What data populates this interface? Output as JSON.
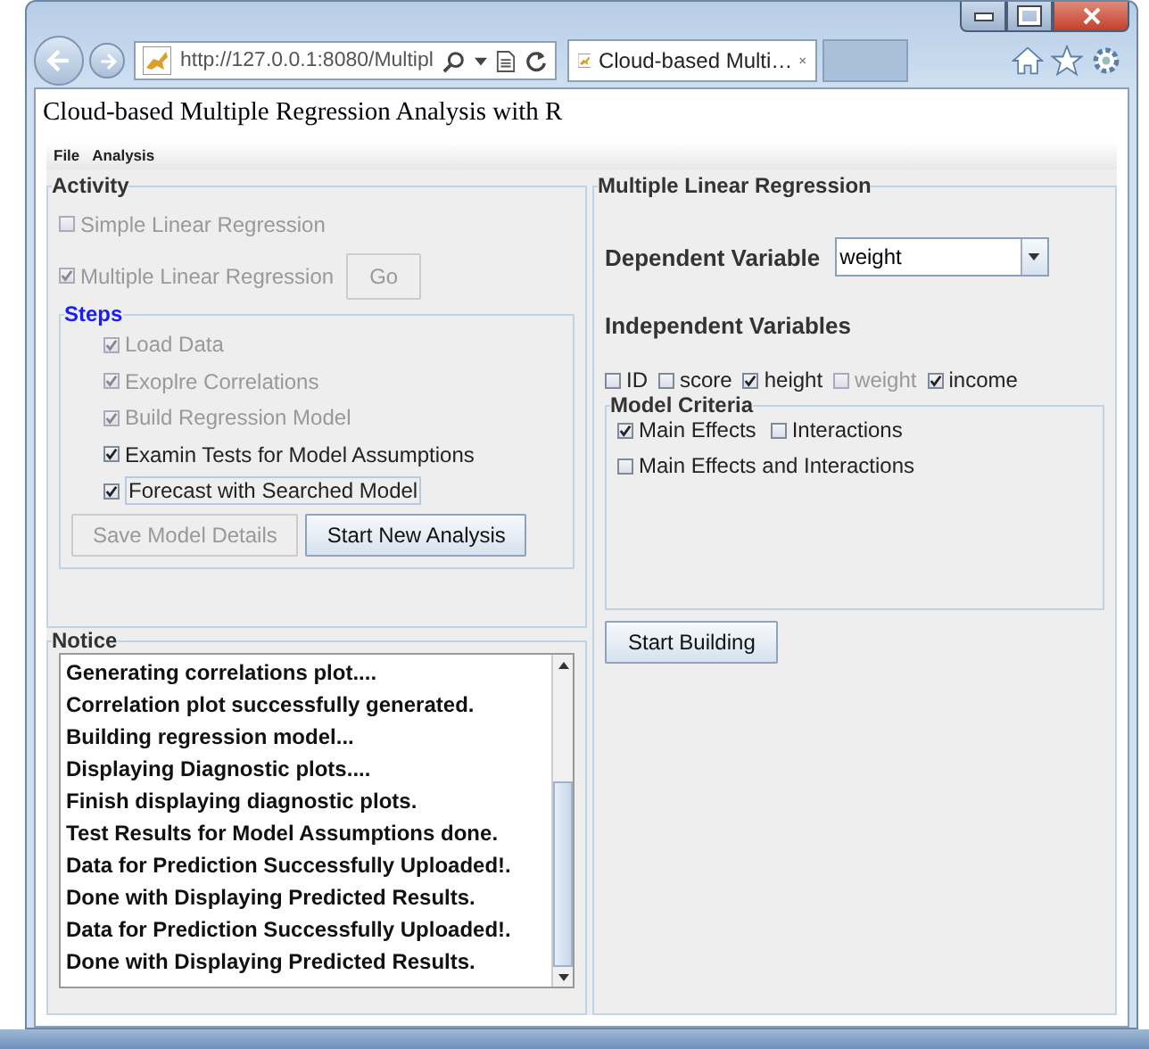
{
  "browser": {
    "url": "http://127.0.0.1:8080/Multipl",
    "tab_title": "Cloud-based Multi…"
  },
  "page_title": "Cloud-based Multiple Regression Analysis with R",
  "menu": [
    "File",
    "Analysis"
  ],
  "activity": {
    "title": "Activity",
    "options": [
      {
        "label": "Simple Linear Regression",
        "checked": false,
        "disabled": true
      },
      {
        "label": "Multiple Linear Regression",
        "checked": true,
        "disabled": true
      }
    ],
    "go_button": {
      "label": "Go",
      "disabled": true
    },
    "steps": {
      "title": "Steps",
      "items": [
        {
          "label": "Load Data",
          "checked": true,
          "disabled": true,
          "focused": false
        },
        {
          "label": "Exoplre Correlations",
          "checked": true,
          "disabled": true,
          "focused": false
        },
        {
          "label": "Build Regression Model",
          "checked": true,
          "disabled": true,
          "focused": false
        },
        {
          "label": "Examin Tests for Model Assumptions",
          "checked": true,
          "disabled": false,
          "focused": false
        },
        {
          "label": "Forecast with Searched Model",
          "checked": true,
          "disabled": false,
          "focused": true
        }
      ],
      "buttons": [
        {
          "label": "Save Model Details",
          "disabled": true
        },
        {
          "label": "Start New Analysis",
          "disabled": false
        }
      ]
    }
  },
  "notice": {
    "title": "Notice",
    "lines": [
      "Generating correlations plot....",
      "Correlation plot successfully generated.",
      "Building regression model...",
      "Displaying Diagnostic plots....",
      "Finish displaying diagnostic plots.",
      "Test Results for Model Assumptions done.",
      "Data for Prediction Successfully Uploaded!.",
      "Done with Displaying Predicted  Results.",
      "Data for Prediction Successfully Uploaded!.",
      "Done with Displaying Predicted  Results."
    ]
  },
  "regression": {
    "title": "Multiple Linear Regression",
    "dependent_label": "Dependent Variable",
    "dependent_value": "weight",
    "independent_label": "Independent Variables",
    "variables": [
      {
        "label": "ID",
        "checked": false,
        "disabled": false
      },
      {
        "label": "score",
        "checked": false,
        "disabled": false
      },
      {
        "label": "height",
        "checked": true,
        "disabled": false
      },
      {
        "label": "weight",
        "checked": false,
        "disabled": true
      },
      {
        "label": "income",
        "checked": true,
        "disabled": false
      }
    ],
    "criteria": {
      "title": "Model Criteria",
      "options": [
        {
          "label": "Main Effects",
          "checked": true
        },
        {
          "label": "Interactions",
          "checked": false
        },
        {
          "label": "Main Effects and Interactions",
          "checked": false
        }
      ]
    },
    "build_button": "Start Building"
  }
}
